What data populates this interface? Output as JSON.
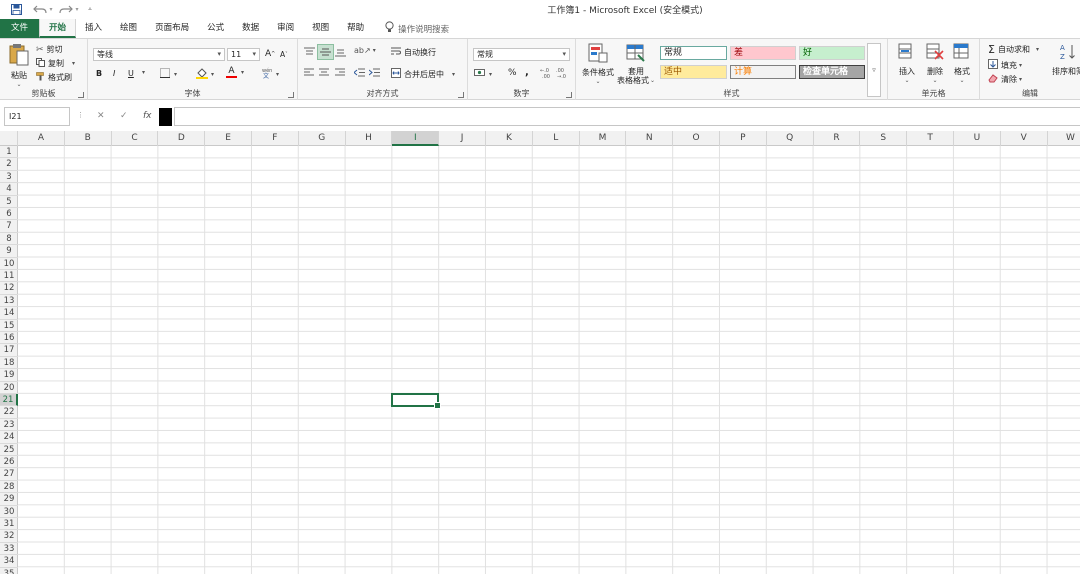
{
  "window": {
    "title": "工作簿1  -  Microsoft Excel (安全模式)"
  },
  "quick_access": {
    "save_icon": "save-icon",
    "undo_icon": "undo-icon",
    "redo_icon": "redo-icon",
    "customize_icon": "customize-qat-icon"
  },
  "tabs": [
    {
      "label": "文件"
    },
    {
      "label": "开始"
    },
    {
      "label": "插入"
    },
    {
      "label": "绘图"
    },
    {
      "label": "页面布局"
    },
    {
      "label": "公式"
    },
    {
      "label": "数据"
    },
    {
      "label": "审阅"
    },
    {
      "label": "视图"
    },
    {
      "label": "帮助"
    }
  ],
  "tell_me": "操作说明搜索",
  "ribbon": {
    "clipboard": {
      "label": "剪贴板",
      "paste": "粘贴",
      "cut": "剪切",
      "copy": "复制",
      "format_painter": "格式刷"
    },
    "font": {
      "label": "字体",
      "font_name": "等线",
      "font_size": "11",
      "bold": "B",
      "italic": "I",
      "underline": "U",
      "grow": "A",
      "shrink": "A",
      "font_color": "A"
    },
    "alignment": {
      "label": "对齐方式",
      "wrap_text": "自动换行",
      "merge_center": "合并后居中"
    },
    "number": {
      "label": "数字",
      "format": "常规",
      "percent": "%",
      "comma": ","
    },
    "styles": {
      "label": "样式",
      "conditional": "条件格式",
      "table_format_1": "套用",
      "table_format_2": "表格格式",
      "normal": "常规",
      "bad": "差",
      "good": "好",
      "neutral": "适中",
      "calculation": "计算",
      "check_cell": "检查单元格",
      "colors": {
        "normal_bg": "#ffffff",
        "normal_border": "#69a9a0",
        "bad_bg": "#ffc7ce",
        "bad_fg": "#9c0006",
        "good_bg": "#c6efce",
        "good_fg": "#006100",
        "neutral_bg": "#ffeb9c",
        "neutral_fg": "#9c5700",
        "calc_bg": "#f2f2f2",
        "calc_fg": "#fa7d00",
        "check_bg": "#a5a5a5",
        "check_fg": "#ffffff"
      }
    },
    "cells": {
      "label": "单元格",
      "insert": "插入",
      "delete": "删除",
      "format": "格式"
    },
    "editing": {
      "label": "编辑",
      "autosum": "自动求和",
      "fill": "填充",
      "clear": "清除",
      "sort": "排序和筛"
    }
  },
  "formula_bar": {
    "name_box": "I21",
    "cancel": "✕",
    "enter": "✓",
    "fx": "fx",
    "value": ""
  },
  "grid": {
    "columns": [
      "A",
      "B",
      "C",
      "D",
      "E",
      "F",
      "G",
      "H",
      "I",
      "J",
      "K",
      "L",
      "M",
      "N",
      "O",
      "P",
      "Q",
      "R",
      "S",
      "T",
      "U",
      "V",
      "W"
    ],
    "rows": [
      "1",
      "2",
      "3",
      "4",
      "5",
      "6",
      "7",
      "8",
      "9",
      "10",
      "11",
      "12",
      "13",
      "14",
      "15",
      "16",
      "17",
      "18",
      "19",
      "20",
      "21",
      "22",
      "23",
      "24",
      "25",
      "26",
      "27",
      "28",
      "29",
      "30",
      "31",
      "32",
      "33",
      "34",
      "35"
    ],
    "selected_column": "I",
    "selected_row": "21",
    "accent": "#217346"
  }
}
